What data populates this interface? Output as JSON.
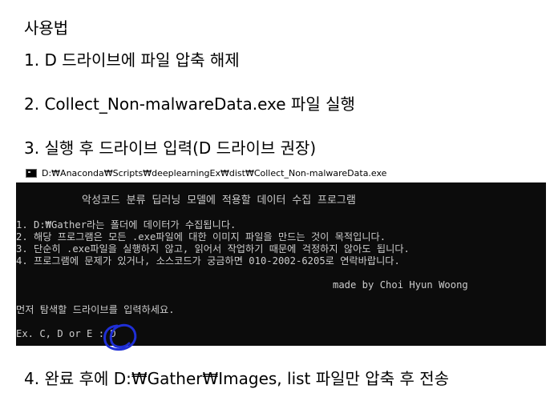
{
  "doc": {
    "title": "사용법",
    "step1": "1. D 드라이브에 파일 압축 해제",
    "step2": "2. Collect_Non-malwareData.exe 파일 실행",
    "step3": "3. 실행 후 드라이브 입력(D 드라이브 권장)",
    "step4": "4.  완료 후에 D:₩Gather₩Images, list 파일만 압축 후 전송"
  },
  "window": {
    "title": "D:₩Anaconda₩Scripts₩deeplearningEx₩dist₩Collect_Non-malwareData.exe",
    "icon": "console-app-icon"
  },
  "console": {
    "header": "악성코드 분류 딥러닝 모델에 적용할 데이터 수집 프로그램",
    "info": [
      "1. D:₩Gather라는 폴더에 데이터가 수집됩니다.",
      "2. 해당 프로그램은 모든 .exe파일에 대한 이미지 파일을 만드는 것이 목적입니다.",
      "3. 단순히 .exe파일을 실행하지 않고, 읽어서 작업하기 때문에 걱정하지 않아도 됩니다.",
      "4. 프로그램에 문제가 있거나, 소스코드가 궁금하면 010-2002-6205로 연락바랍니다."
    ],
    "credit": "made by Choi Hyun Woong",
    "prompt": "먼저 탐색할 드라이브를 입력하세요.",
    "input_line": "Ex. C, D or E : D"
  },
  "colors": {
    "console_bg": "#0c0c0c",
    "console_fg": "#cccccc",
    "annotation": "#1f2fd6"
  }
}
